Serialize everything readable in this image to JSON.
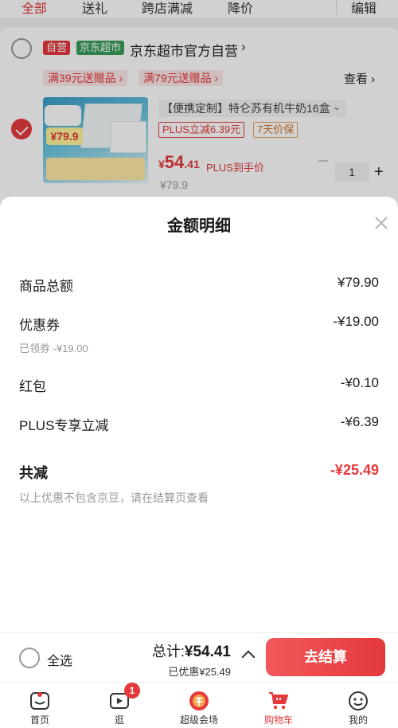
{
  "cart_tabs": [
    "全部",
    "送礼",
    "跨店满减",
    "降价"
  ],
  "edit_label": "编辑",
  "shop": {
    "tag_self": "自营",
    "tag_supermarket": "京东超市",
    "name": "京东超市官方自营",
    "name_chevron": "›",
    "promos": [
      "满39元送赠品 ›",
      "满79元送赠品 ›"
    ],
    "view_more": "查看 ›"
  },
  "product": {
    "image_badge_price": "¥79.9",
    "title": "【便携定制】特仑苏有机牛奶16盒",
    "sku_chevron": "⌄",
    "plus_discount": "PLUS立减6.39元",
    "price_protect": "7天价保",
    "price_currency": "¥",
    "price_int": "54",
    "price_dec": ".41",
    "plus_hint": "PLUS到手价",
    "quantity": "1",
    "original_price": "¥79.9"
  },
  "sheet": {
    "title": "金额明细",
    "rows": [
      {
        "label": "商品总额",
        "value": "¥79.90"
      },
      {
        "label": "优惠券",
        "value": "-¥19.00",
        "sub": "已领券 -¥19.00"
      },
      {
        "label": "红包",
        "value": "-¥0.10"
      },
      {
        "label": "PLUS专享立减",
        "value": "-¥6.39"
      }
    ],
    "total_label": "共减",
    "total_value": "-¥25.49",
    "note": "以上优惠不包含京豆，请在结算页查看"
  },
  "checkout": {
    "select_all": "全选",
    "total_prefix": "总计:",
    "total_amount": "¥54.41",
    "saved": "已优惠¥25.49",
    "button": "去结算"
  },
  "tabbar": [
    {
      "label": "首页",
      "icon": "home-icon"
    },
    {
      "label": "逛",
      "icon": "video-icon",
      "badge": "1"
    },
    {
      "label": "超级会场",
      "icon": "super-venue-icon"
    },
    {
      "label": "购物车",
      "icon": "cart-icon",
      "active": true
    },
    {
      "label": "我的",
      "icon": "profile-icon"
    }
  ],
  "colors": {
    "accent": "#e4393c",
    "supermarket_tag": "#3a9e5b",
    "promo_bg": "#fde8e8"
  }
}
